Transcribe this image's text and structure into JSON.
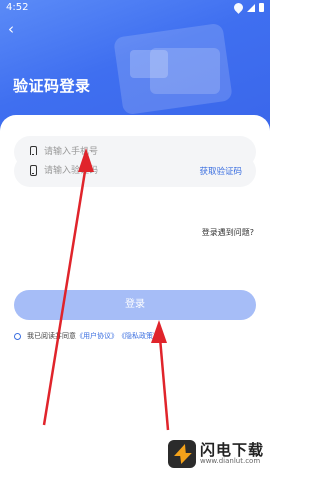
{
  "status_bar": {
    "time": "4:52"
  },
  "header": {
    "back_label": "‹",
    "title": "验证码登录"
  },
  "form": {
    "phone_placeholder": "请输入手机号",
    "code_placeholder": "请输入验证码",
    "get_code_label": "获取验证码",
    "problem_label": "登录遇到问题?",
    "login_label": "登录"
  },
  "agreement": {
    "prefix": "我已阅读并同意",
    "user_agreement": "《用户协议》",
    "privacy_policy": "《隐私政策》"
  },
  "watermark": {
    "name": "闪电下载",
    "url": "www.dianlut.com"
  },
  "colors": {
    "hero": "#3f6ff0",
    "accent": "#3b6fe0",
    "login_button": "#a6bdf7",
    "arrow": "#e0242b"
  },
  "icons": [
    "back-icon",
    "phone-icon",
    "signal-icon",
    "wifi-icon",
    "battery-icon"
  ]
}
